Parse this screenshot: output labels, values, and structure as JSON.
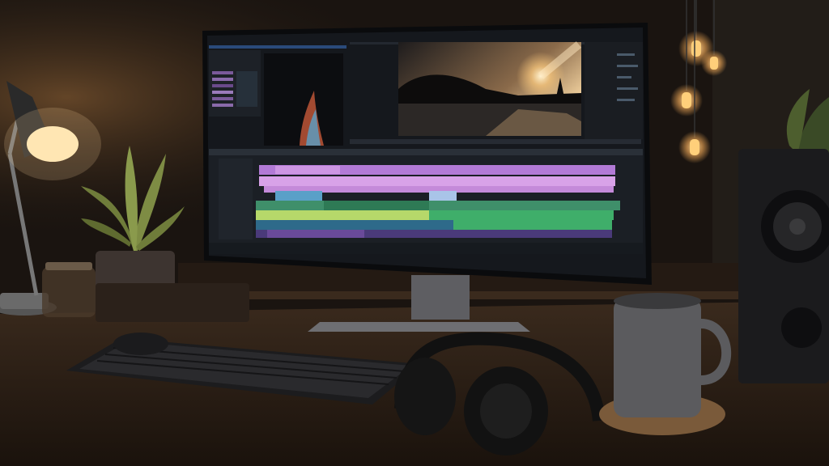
{
  "scene": {
    "colors": {
      "wall": "#1a1410",
      "desk": "#2a1e16",
      "lamp_glow": "#ffd9a0",
      "bulb": "#ffb35c",
      "screen_bg": "#15181d",
      "panel": "#1d2127",
      "clip_violet": "#b27ad6",
      "clip_pink": "#d8a2e8",
      "clip_blue": "#5aa0c8",
      "clip_green": "#3fae6a",
      "clip_lime": "#b6d86a",
      "clip_teal": "#3e8f8a",
      "mug": "#5b5b5e",
      "speaker": "#1b1b1d"
    },
    "objects": [
      "desk-lamp-icon",
      "potted-plant-icon",
      "glass-jar-icon",
      "monitor-icon",
      "keyboard-icon",
      "mouse-icon",
      "headphones-icon",
      "mug-icon",
      "coaster-icon",
      "speaker-icon",
      "hanging-bulb-icon"
    ]
  }
}
